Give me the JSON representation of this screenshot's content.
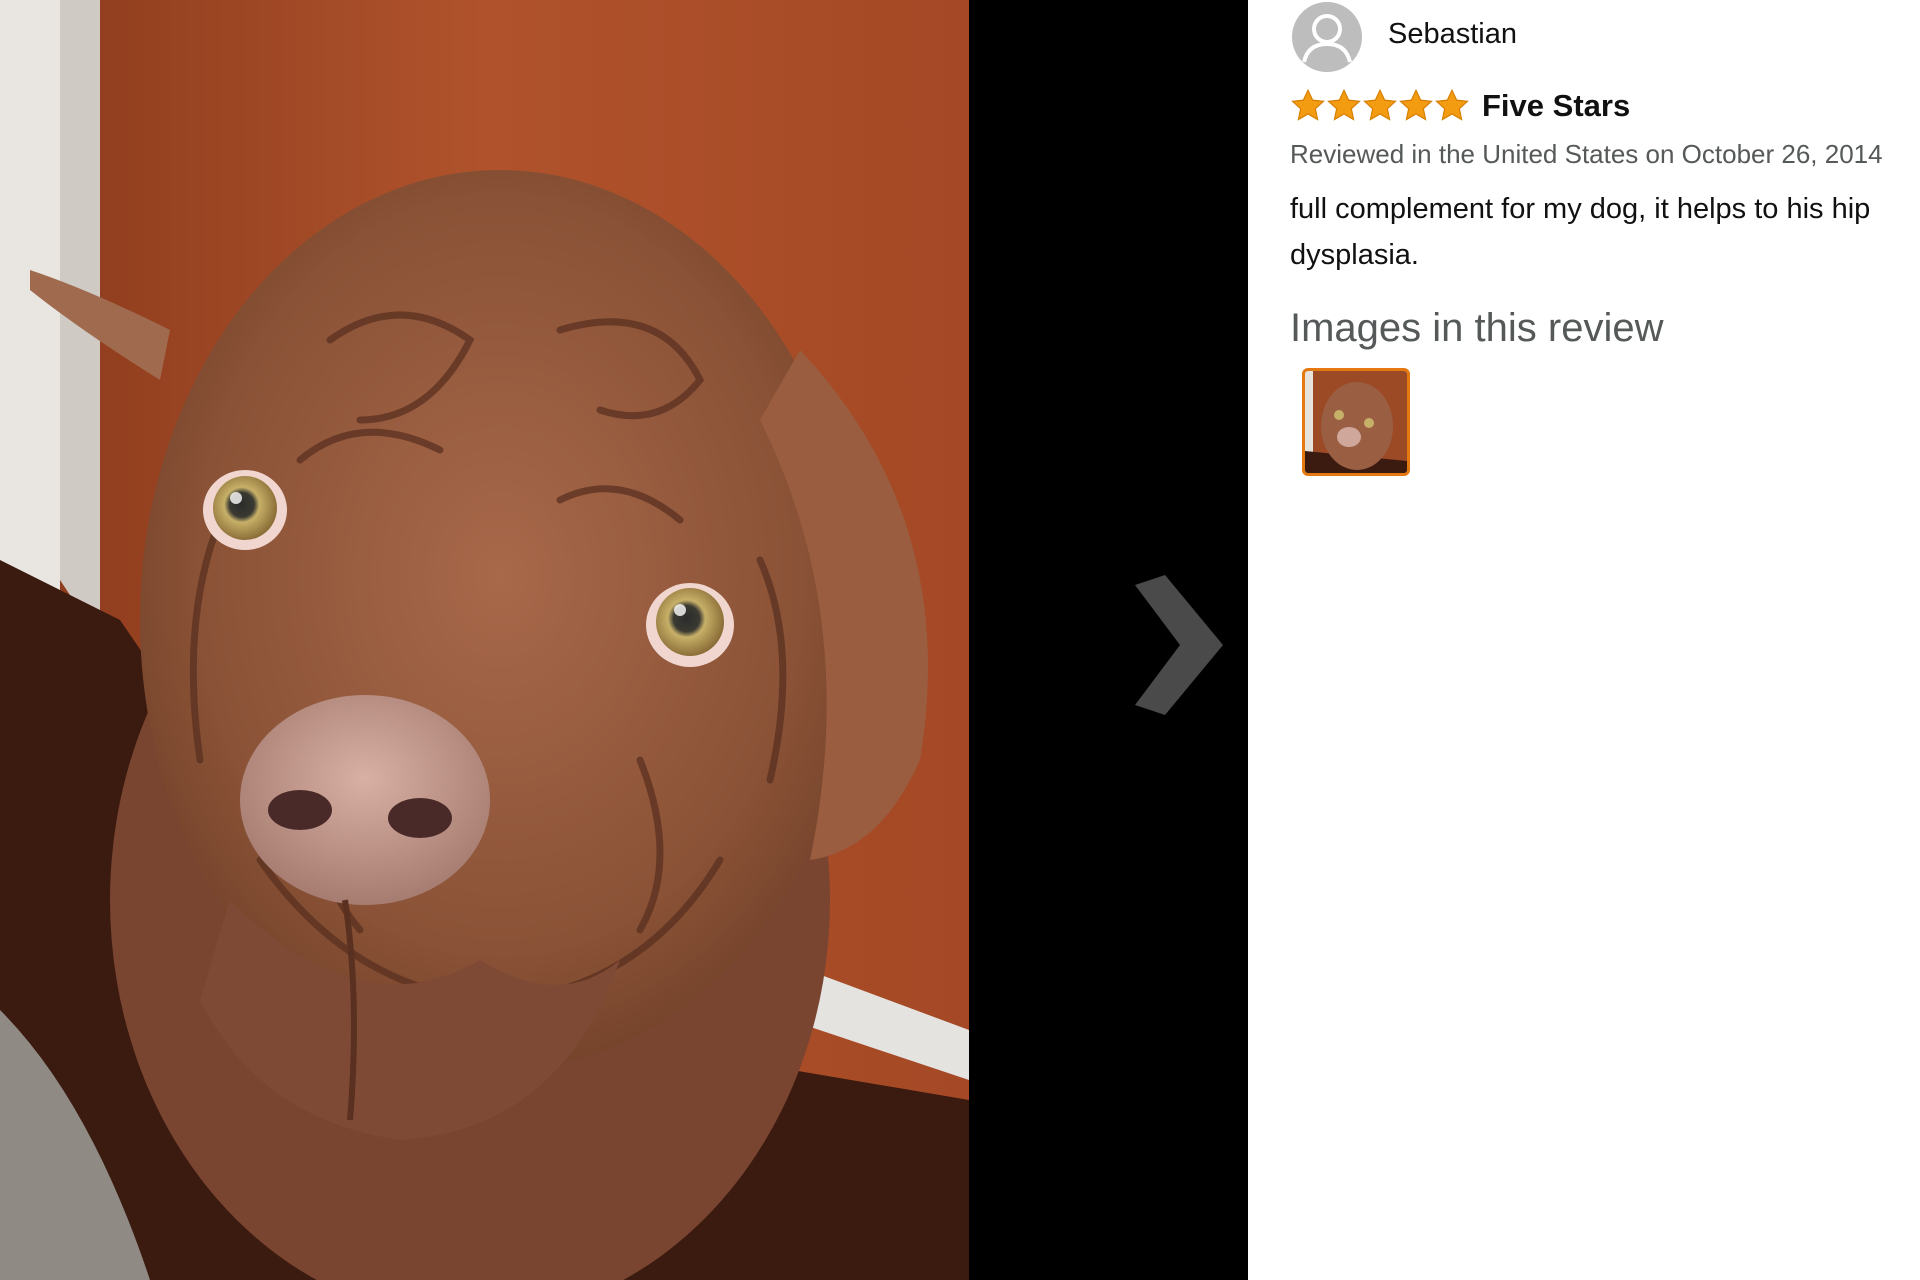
{
  "reviewer": {
    "name": "Sebastian",
    "avatar_icon": "user-avatar-icon"
  },
  "rating": {
    "stars": 5,
    "max": 5,
    "star_color": "#f39c12"
  },
  "review": {
    "title": "Five Stars",
    "meta": "Reviewed in the United States on October 26, 2014",
    "body": "full complement for my dog, it helps to his hip dysplasia."
  },
  "images": {
    "heading": "Images in this review",
    "thumbnail_border_color": "#e47911"
  },
  "viewer": {
    "next_icon": "chevron-right-icon"
  }
}
